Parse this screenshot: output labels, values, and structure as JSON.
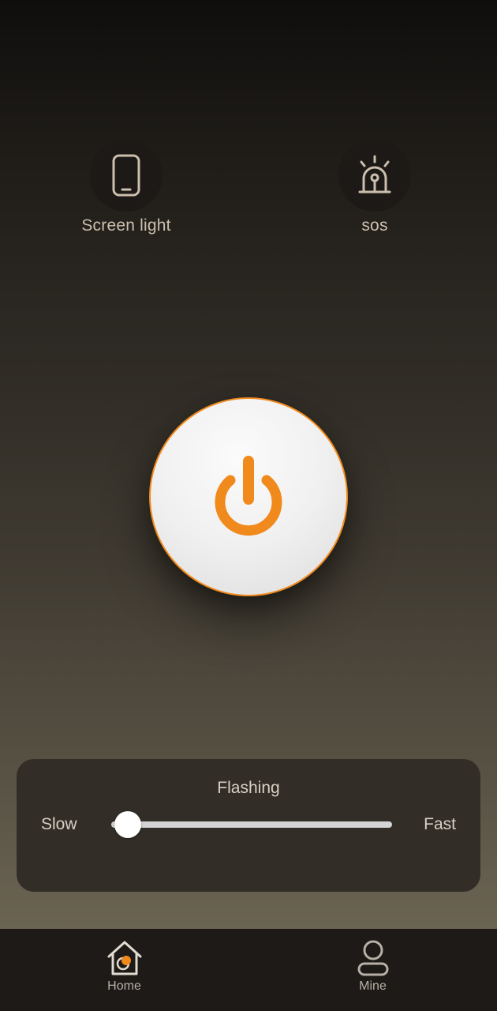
{
  "modes": [
    {
      "label": "Screen light",
      "icon": "phone-icon"
    },
    {
      "label": "sos",
      "icon": "siren-icon"
    }
  ],
  "power": {
    "icon": "power-icon",
    "state": "off"
  },
  "flashing": {
    "title": "Flashing",
    "min_label": "Slow",
    "max_label": "Fast",
    "level": 0.06
  },
  "nav": [
    {
      "label": "Home",
      "icon": "home-icon",
      "active": true
    },
    {
      "label": "Mine",
      "icon": "user-icon",
      "active": false
    }
  ],
  "colors": {
    "accent": "#f08a1d",
    "icon_stroke": "#cbbfae",
    "panel": "#322d27",
    "nav_bg": "#1d1a17"
  }
}
